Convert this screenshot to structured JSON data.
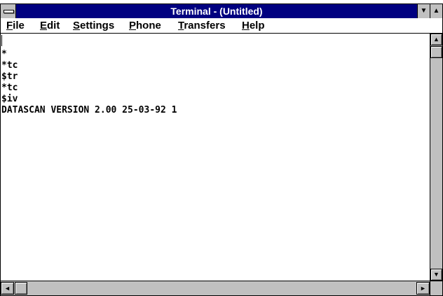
{
  "window": {
    "title": "Terminal - (Untitled)"
  },
  "titlebar_icons": {
    "system_menu": "system-menu-icon",
    "minimize": "minimize-arrow-icon",
    "maximize": "maximize-arrow-icon"
  },
  "menubar": {
    "items": [
      {
        "mnemonic": "F",
        "rest": "ile"
      },
      {
        "mnemonic": "E",
        "rest": "dit"
      },
      {
        "mnemonic": "S",
        "rest": "ettings"
      },
      {
        "mnemonic": "P",
        "rest": "hone"
      },
      {
        "mnemonic": "T",
        "rest": "ransfers"
      },
      {
        "mnemonic": "H",
        "rest": "elp"
      }
    ]
  },
  "terminal": {
    "lines": [
      "*",
      "*tc",
      "$tr",
      "*tc",
      "$iv",
      "DATASCAN VERSION 2.00 25-03-92 1"
    ]
  },
  "scrollbars": {
    "up": "▲",
    "down": "▼",
    "left": "◄",
    "right": "►"
  },
  "colors": {
    "titlebar": "#000080",
    "chrome": "#c0c0c0",
    "terminal_bg": "#ffffff"
  }
}
